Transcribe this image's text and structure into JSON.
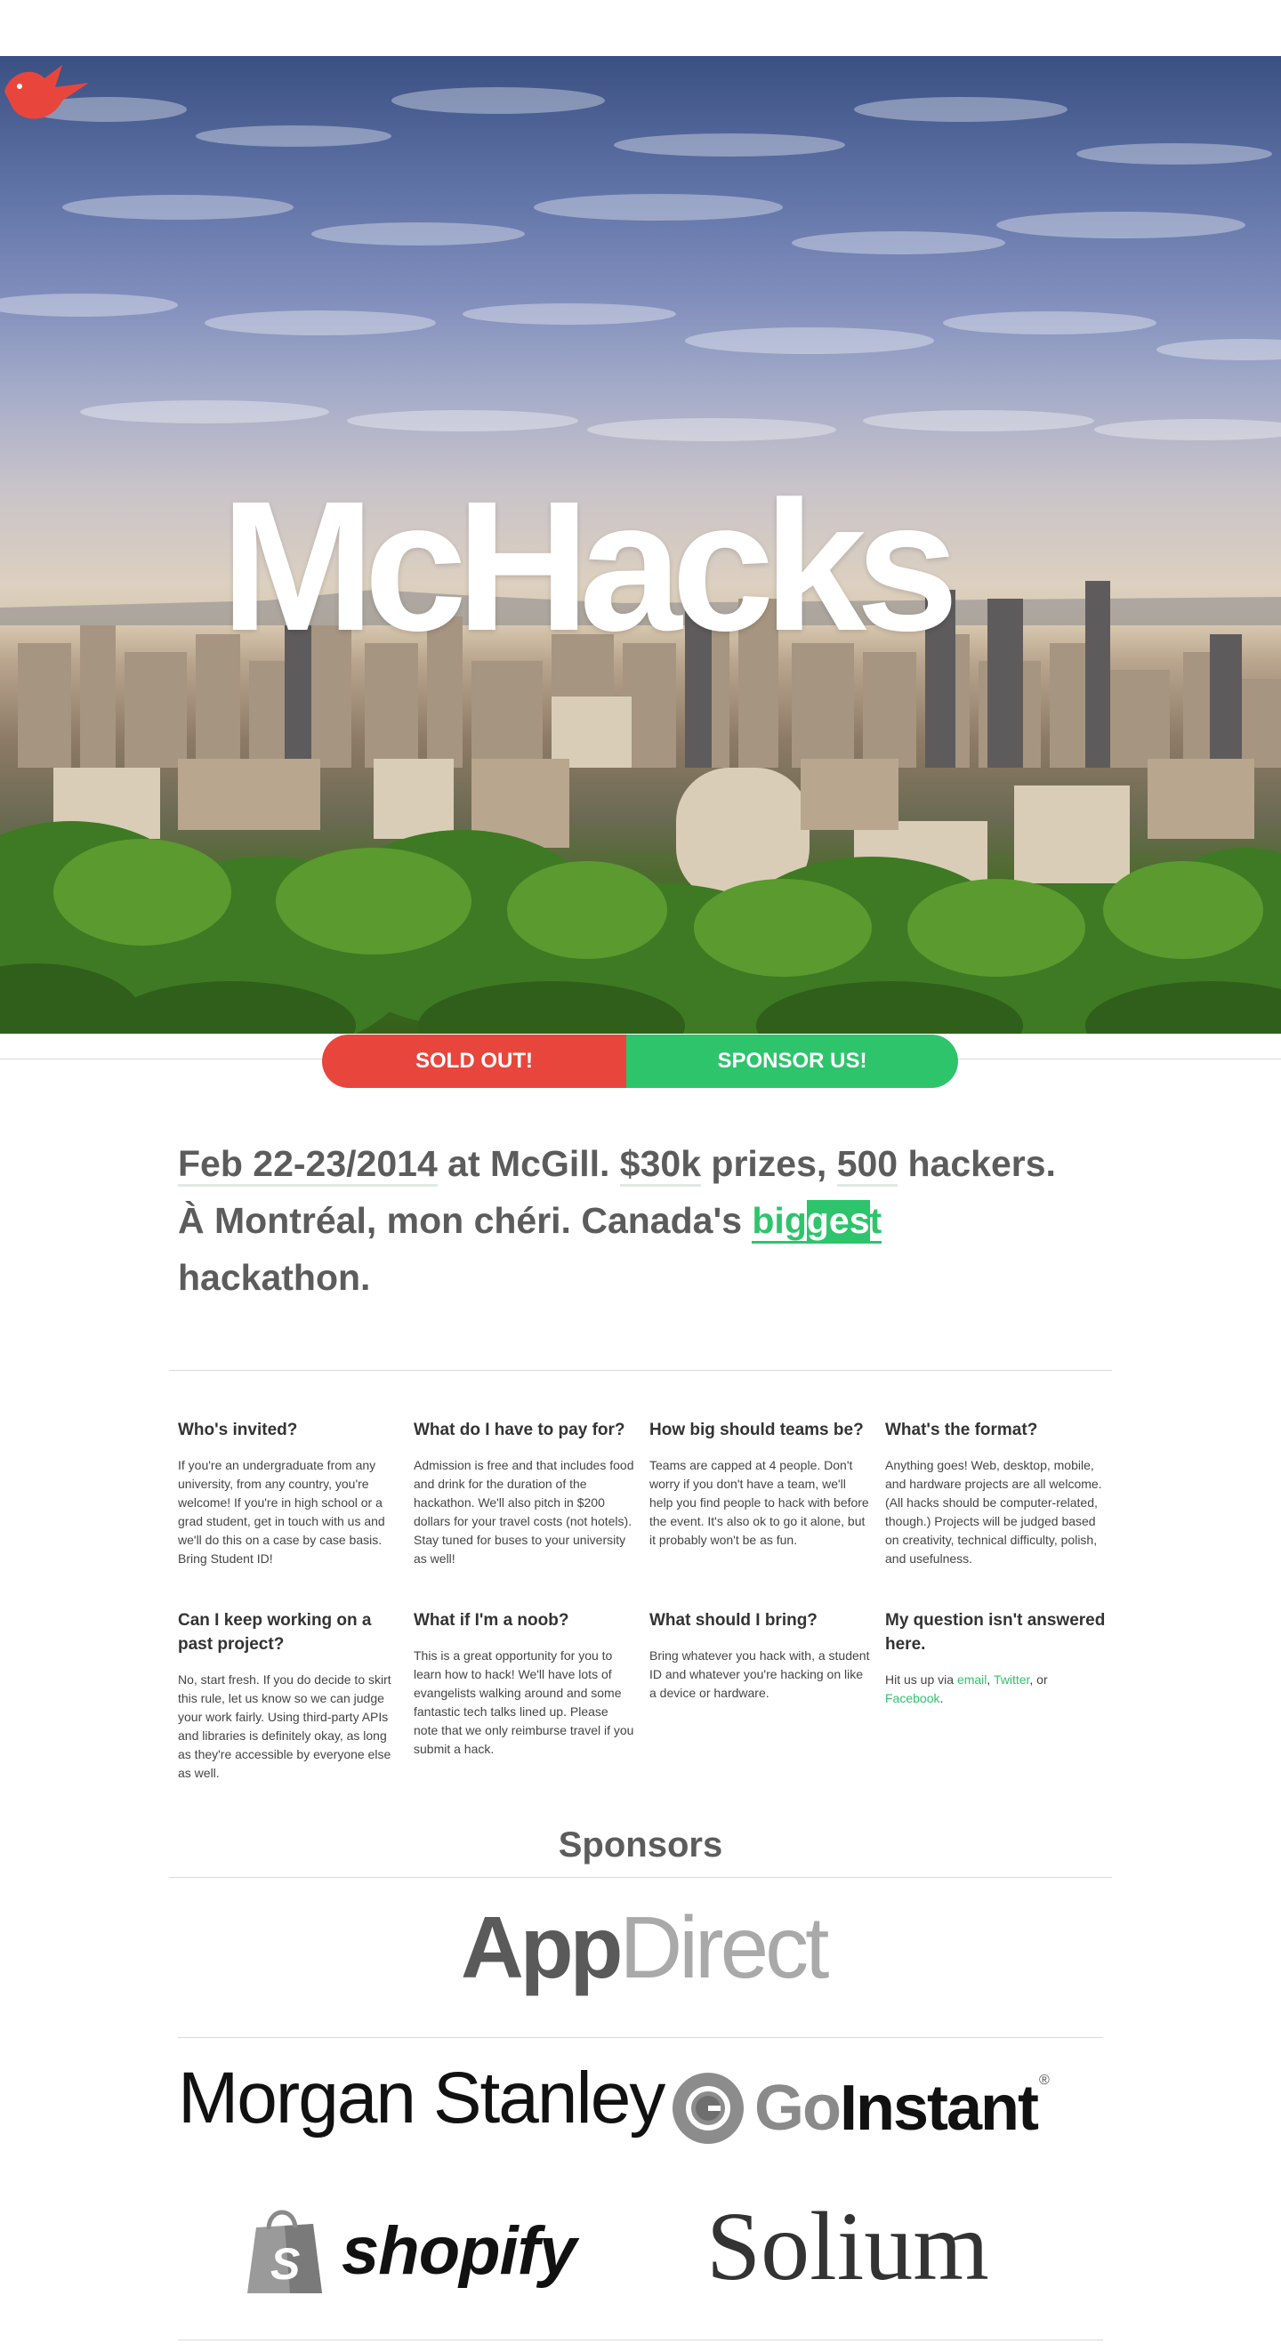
{
  "hero": {
    "logo_text": "McHacks",
    "bird_icon": "red-bird-icon"
  },
  "buttons": {
    "sold_out": "SOLD OUT!",
    "sponsor_us": "SPONSOR US!"
  },
  "tagline": {
    "date": "Feb 22-23/2014",
    "at_mcgill": " at McGill. ",
    "prize": "$30k",
    "prizes_text": " prizes, ",
    "hackers_count": "500",
    "hackers_text": " hackers.",
    "line2_prefix": "À Montréal, mon chéri. Canada's ",
    "big_a": "big",
    "big_b": "ges",
    "big_c": "t",
    "line3": "hackathon."
  },
  "faq": [
    {
      "q": "Who's invited?",
      "a": "If you're an undergraduate from any university, from any country, you're welcome! If you're in high school or a grad student, get in touch with us and we'll do this on a case by case basis. Bring Student ID!"
    },
    {
      "q": "What do I have to pay for?",
      "a": "Admission is free and that includes food and drink for the duration of the hackathon. We'll also pitch in $200 dollars for your travel costs (not hotels). Stay tuned for buses to your university as well!"
    },
    {
      "q": "How big should teams be?",
      "a": "Teams are capped at 4 people. Don't worry if you don't have a team, we'll help you find people to hack with before the event. It's also ok to go it alone, but it probably won't be as fun."
    },
    {
      "q": "What's the format?",
      "a": "Anything goes! Web, desktop, mobile, and hardware projects are all welcome. (All hacks should be computer-related, though.) Projects will be judged based on creativity, technical difficulty, polish, and usefulness."
    },
    {
      "q": "Can I keep working on a past project?",
      "a": "No, start fresh. If you do decide to skirt this rule, let us know so we can judge your work fairly. Using third-party APIs and libraries is definitely okay, as long as they're accessible by everyone else as well."
    },
    {
      "q": "What if I'm a noob?",
      "a": "This is a great opportunity for you to learn how to hack! We'll have lots of evangelists walking around and some fantastic tech talks lined up. Please note that we only reimburse travel if you submit a hack."
    },
    {
      "q": "What should I bring?",
      "a": "Bring whatever you hack with, a student ID and whatever you're hacking on like a device or hardware."
    },
    {
      "q": "My question isn't answered here.",
      "a_prefix": "Hit us up via ",
      "link_email": "email",
      "sep1": ", ",
      "link_twitter": "Twitter",
      "sep2": ", or ",
      "link_facebook": "Facebook",
      "a_suffix": "."
    }
  ],
  "sponsors": {
    "title": "Sponsors",
    "appdirect_a": "App",
    "appdirect_b": "Direct",
    "morgan_stanley": "Morgan Stanley",
    "goinstant_go": "Go",
    "goinstant_instant": "Instant",
    "goinstant_reg": "®",
    "shopify": "shopify",
    "solium": "Solium"
  }
}
